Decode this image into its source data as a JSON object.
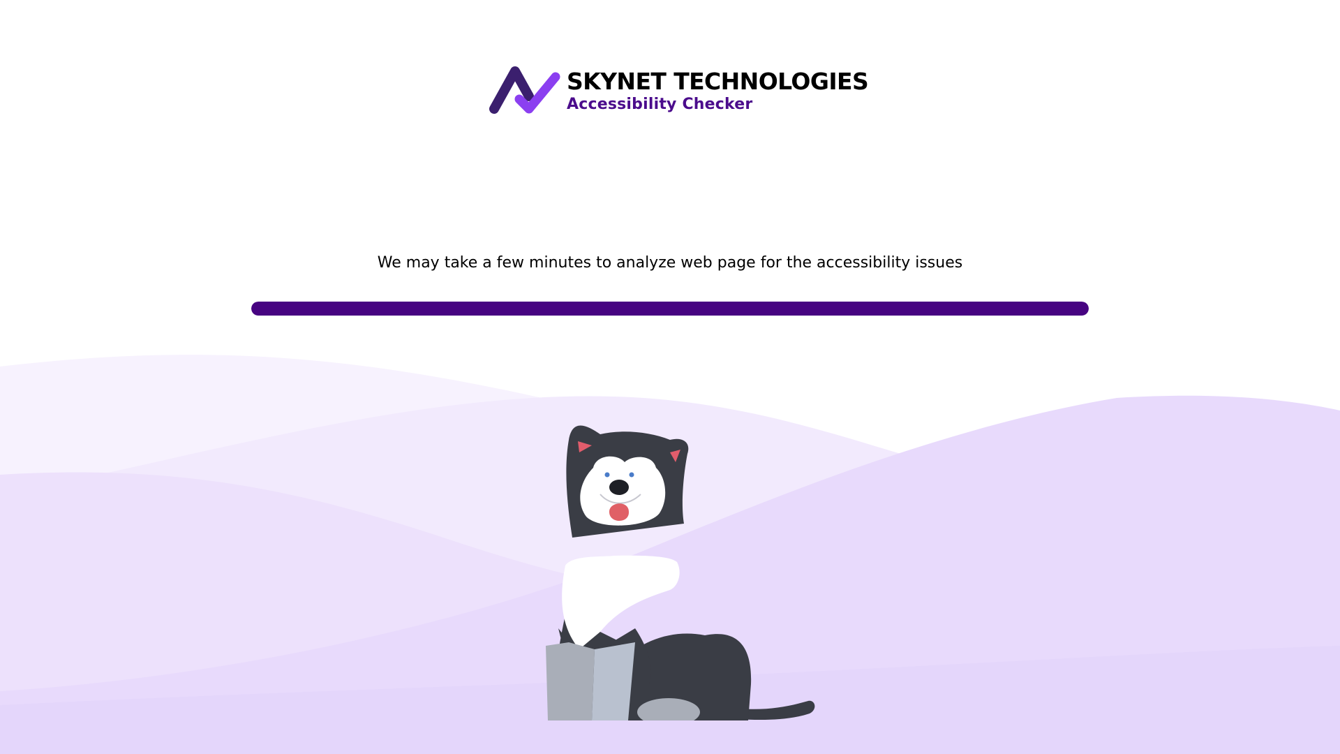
{
  "brand": {
    "name": "SKYNET TECHNOLOGIES",
    "product": "Accessibility Checker",
    "logo_icon": "checkmark-a-logo-icon"
  },
  "status": {
    "message": "We may take a few minutes to analyze web page for the accessibility issues"
  },
  "progress": {
    "value": 1.0
  },
  "illustration": {
    "icon": "husky-dog-illustration"
  },
  "colors": {
    "brand_purple": "#470481",
    "logo_dark": "#3b1f6e",
    "logo_light": "#8b3ff0",
    "wave_light": "#f5effd",
    "wave_mid": "#ece1fc",
    "wave_dark": "#e4d6fb"
  }
}
